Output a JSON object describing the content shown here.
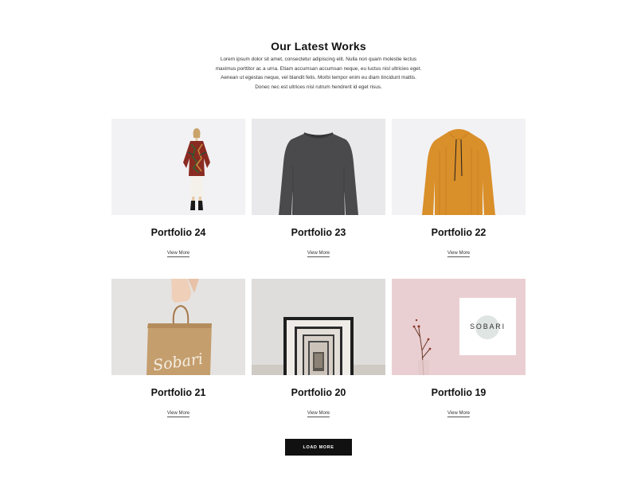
{
  "section": {
    "title": "Our Latest Works",
    "intro_lines": [
      "Lorem ipsum dolor sit amet, consectetur adipiscing elit. Nulla non quam molestie lectus",
      "maximus porttitor ac a urna. Etiam accumsan accumsan neque, eu luctus nisl ultricies eget.",
      "Aenean ut egestas neque, vel blandit felis. Morbi tempor enim eu diam tincidunt mattis.",
      "Donec nec est ultrices nisl rutrum hendrerit id eget risus."
    ]
  },
  "portfolio": {
    "items": [
      {
        "title": "Portfolio 24",
        "link": "View More",
        "image": "woman-in-patterned-cardigan"
      },
      {
        "title": "Portfolio 23",
        "link": "View More",
        "image": "grey-knit-sweater"
      },
      {
        "title": "Portfolio 22",
        "link": "View More",
        "image": "mustard-hoodie"
      },
      {
        "title": "Portfolio 21",
        "link": "View More",
        "image": "hand-holding-paper-bag",
        "bag_text": "Sobari"
      },
      {
        "title": "Portfolio 20",
        "link": "View More",
        "image": "nested-picture-frames"
      },
      {
        "title": "Portfolio 19",
        "link": "View More",
        "image": "sobari-logo-card",
        "logo_text": "SOBARI"
      }
    ],
    "load_more": "LOAD MORE"
  },
  "colors": {
    "background": "#ffffff",
    "text": "#111111",
    "button": "#111111",
    "thumb_light": "#f2f2f4",
    "thumb_pink": "#eacfd2",
    "mustard": "#d98f2a"
  }
}
